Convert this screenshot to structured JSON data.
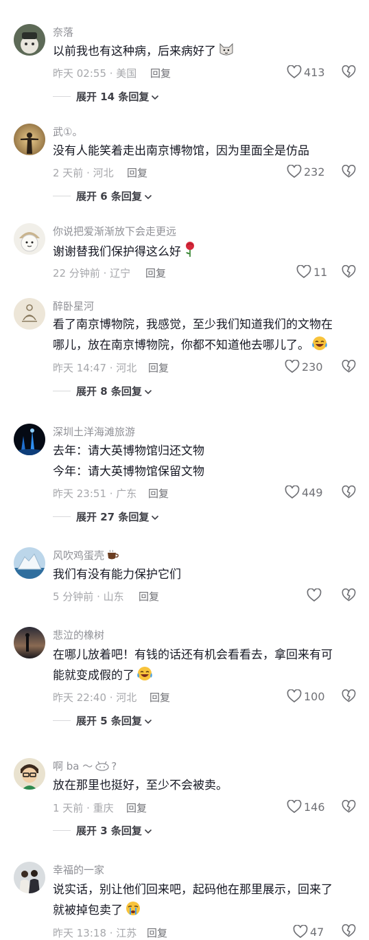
{
  "ui": {
    "reply_label": "回复"
  },
  "comments": [
    {
      "username": "奈落",
      "lines": [
        "以前我也有这种病，后来病好了"
      ],
      "emoji": "cat-face-emoji",
      "time_location": "昨天 02:55 · 美国",
      "likes": "413",
      "expand_label": "展开 14 条回复"
    },
    {
      "username": "武①。",
      "lines": [
        "没有人能笑着走出南京博物馆，因为里面全是仿品"
      ],
      "time_location": "2 天前 · 河北",
      "likes": "232",
      "expand_label": "展开 6 条回复"
    },
    {
      "username": "你说把爱渐渐放下会走更远",
      "lines": [
        "谢谢替我们保护得这么好"
      ],
      "emoji": "rose-emoji",
      "time_location": "22 分钟前 · 辽宁",
      "likes": "11"
    },
    {
      "username": "醉卧星河",
      "lines": [
        "看了南京博物院，我感觉，至少我们知道我们的文物在",
        "哪儿，放在南京博物院，你都不知道他去哪儿了。"
      ],
      "emoji": "laughing-tears-emoji",
      "time_location": "昨天 14:47 · 河北",
      "likes": "230",
      "expand_label": "展开 8 条回复"
    },
    {
      "username": "深圳土洋海滩旅游",
      "lines": [
        "去年：请大英博物馆归还文物",
        "今年：请大英博物馆保留文物"
      ],
      "time_location": "昨天 23:51 · 广东",
      "likes": "449",
      "expand_label": "展开 27 条回复"
    },
    {
      "username": "风吹鸡蛋壳",
      "username_emoji": "coffee-emoji",
      "lines": [
        "我们有没有能力保护它们"
      ],
      "time_location": "5 分钟前 · 山东",
      "likes": ""
    },
    {
      "username": "悲泣的橡树",
      "lines": [
        "在哪儿放着吧！有钱的话还有机会看看去，拿回来有可",
        "能就变成假的了"
      ],
      "emoji": "laughing-tears-emoji",
      "time_location": "昨天 22:40 · 河北",
      "likes": "100",
      "expand_label": "展开 5 条回复"
    },
    {
      "username": "啊 ba ～",
      "username_emoji": "bunny-face-emoji",
      "username_suffix": "?",
      "lines": [
        "放在那里也挺好，至少不会被卖。"
      ],
      "time_location": "1 天前 · 重庆",
      "likes": "146",
      "expand_label": "展开 3 条回复"
    },
    {
      "username": "幸福的一家",
      "lines": [
        "说实话，别让他们回来吧，起码他在那里展示，回来了",
        "就被掉包卖了"
      ],
      "emoji": "crying-face-emoji",
      "time_location": "昨天 13:18 · 江苏",
      "likes": "47"
    }
  ]
}
